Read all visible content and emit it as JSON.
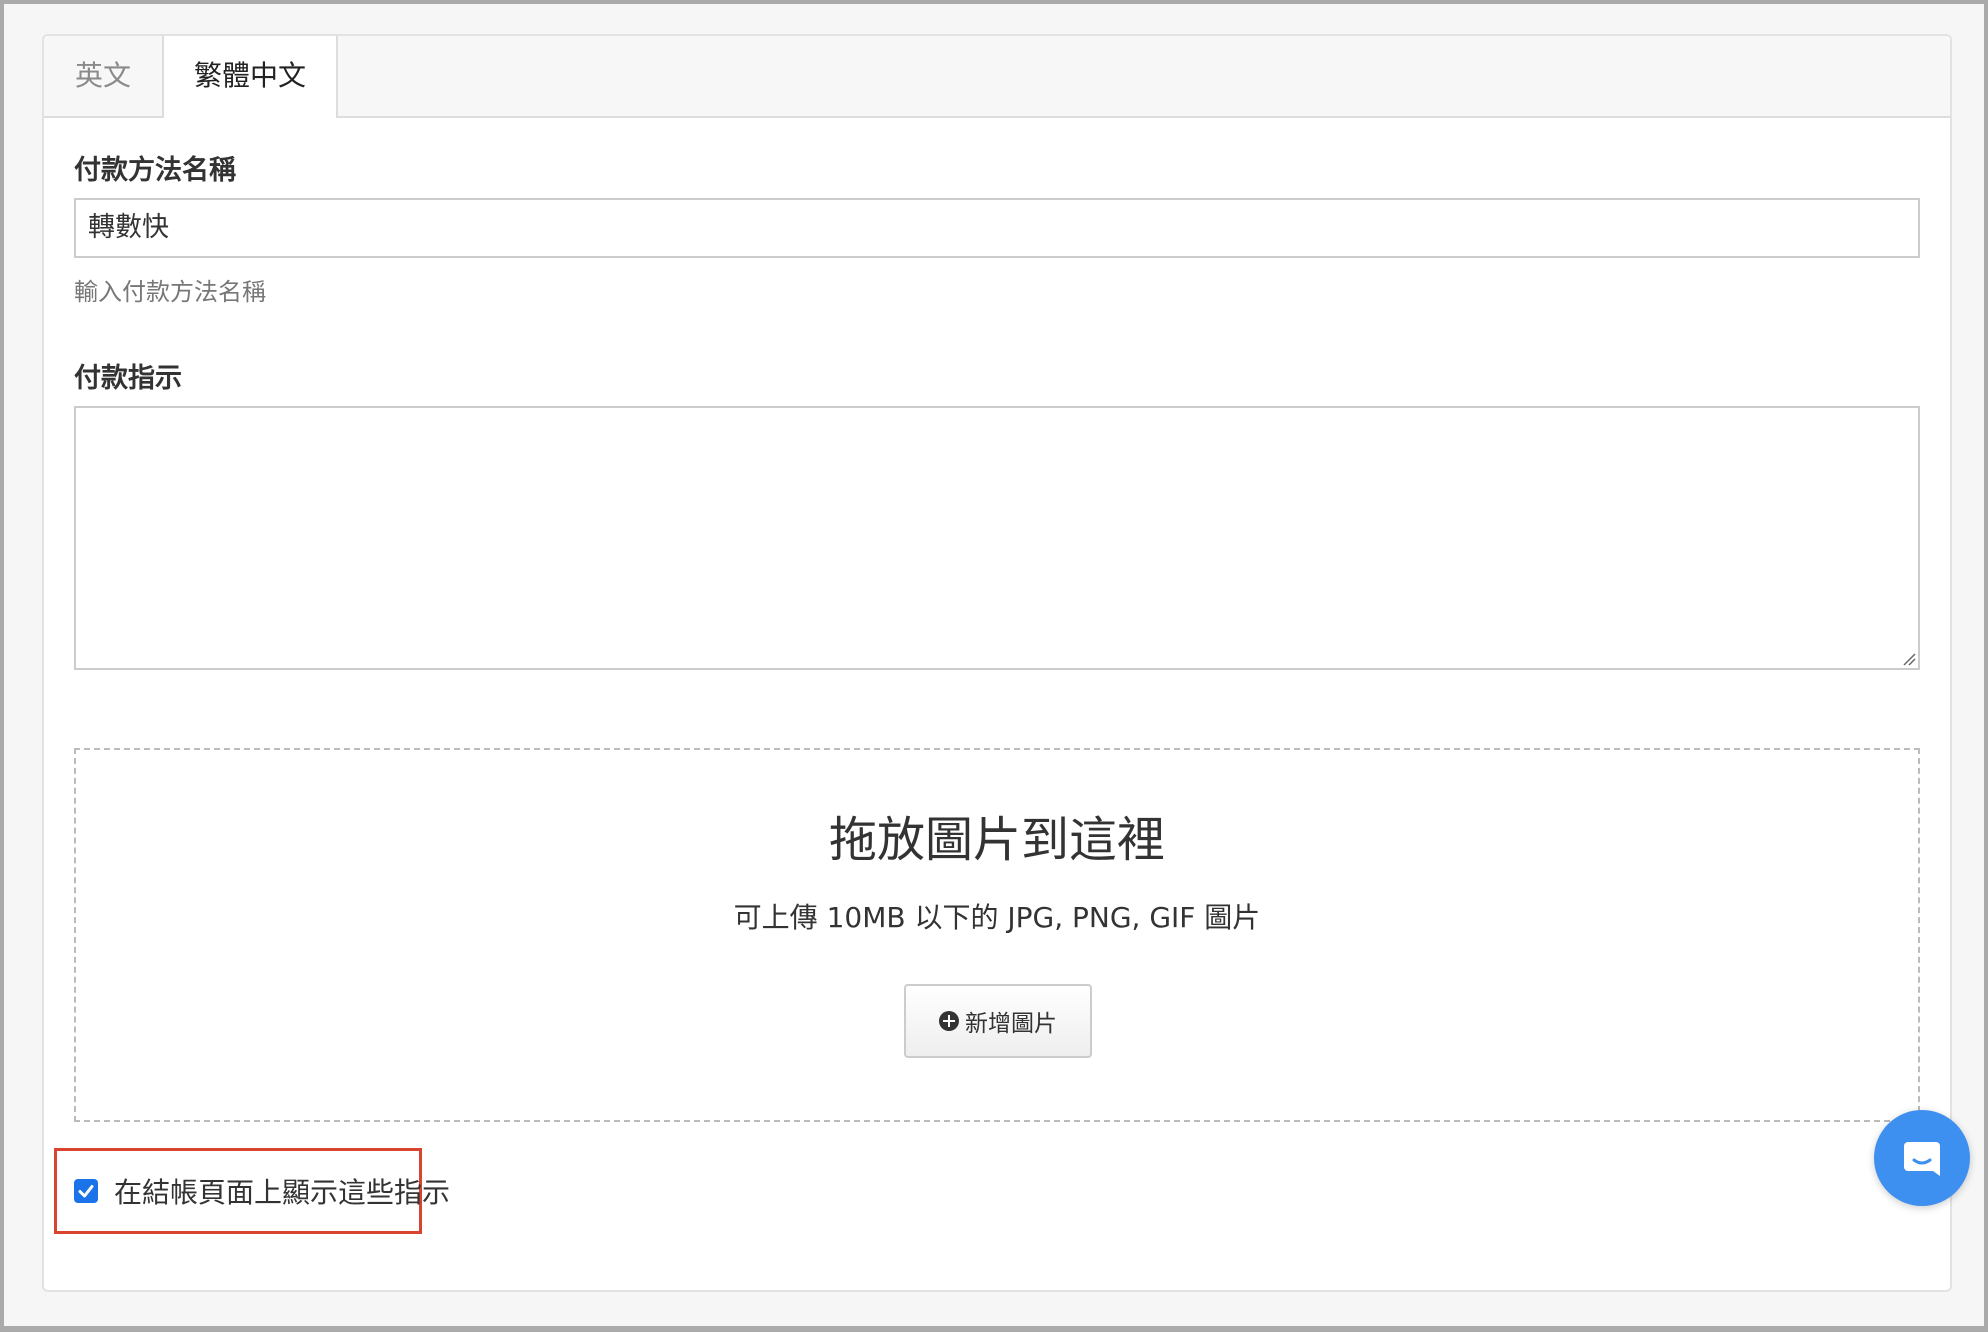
{
  "tabs": [
    {
      "label": "英文",
      "active": false
    },
    {
      "label": "繁體中文",
      "active": true
    }
  ],
  "payment_name": {
    "label": "付款方法名稱",
    "value": "轉數快",
    "help": "輸入付款方法名稱"
  },
  "instructions": {
    "label": "付款指示",
    "value": ""
  },
  "dropzone": {
    "title": "拖放圖片到這裡",
    "subtitle": "可上傳 10MB 以下的 JPG, PNG, GIF 圖片",
    "button_label": "新增圖片"
  },
  "show_on_checkout": {
    "label": "在結帳頁面上顯示這些指示",
    "checked": true
  },
  "colors": {
    "accent": "#1a73e8",
    "chat": "#3d8ff0",
    "highlight": "#d9442e"
  },
  "icons": {
    "add": "plus-circle-icon",
    "chat": "chat-icon",
    "check": "check-icon"
  }
}
